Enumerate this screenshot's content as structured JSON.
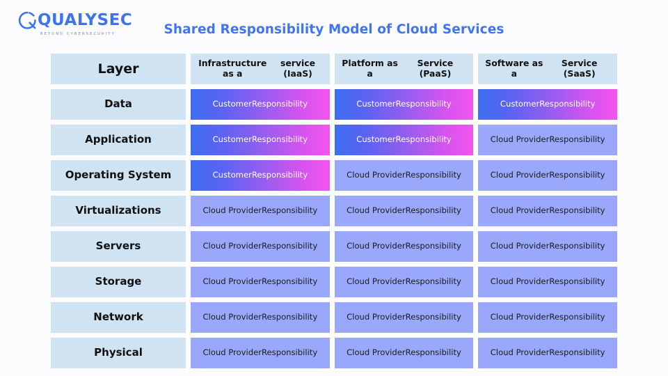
{
  "brand": {
    "name": "QUALYSEC",
    "tagline": "BEYOND CYBERSECURITY",
    "logo_icon": "q-circle-logo-icon",
    "color": "#3c74ef"
  },
  "title": "Shared Responsibility Model of Cloud Services",
  "colors": {
    "title": "#3f75ef",
    "layer_cell": "#cfe3f3",
    "provider_cell": "#99a8fb",
    "customer_gradient_start": "#3f6ff1",
    "customer_gradient_end": "#f355ee",
    "background": "#fcfcfe"
  },
  "labels": {
    "customer": "Customer\nResponsibility",
    "customer_line1": "Customer",
    "customer_line2": "Responsibility",
    "provider_line1": "Cloud Provider",
    "provider_line2": "Responsibility"
  },
  "table": {
    "headers": [
      {
        "line1": "Layer",
        "line2": ""
      },
      {
        "line1": "Infrastructure as a",
        "line2": "service (IaaS)"
      },
      {
        "line1": "Platform as a",
        "line2": "Service  (PaaS)"
      },
      {
        "line1": "Software as a",
        "line2": "Service  (SaaS)"
      }
    ],
    "rows": [
      {
        "layer": "Data",
        "iaas": "customer",
        "paas": "customer",
        "saas": "customer"
      },
      {
        "layer": "Application",
        "iaas": "customer",
        "paas": "customer",
        "saas": "provider"
      },
      {
        "layer": "Operating System",
        "iaas": "customer",
        "paas": "provider",
        "saas": "provider"
      },
      {
        "layer": "Virtualizations",
        "iaas": "provider",
        "paas": "provider",
        "saas": "provider"
      },
      {
        "layer": "Servers",
        "iaas": "provider",
        "paas": "provider",
        "saas": "provider"
      },
      {
        "layer": "Storage",
        "iaas": "provider",
        "paas": "provider",
        "saas": "provider"
      },
      {
        "layer": "Network",
        "iaas": "provider",
        "paas": "provider",
        "saas": "provider"
      },
      {
        "layer": "Physical",
        "iaas": "provider",
        "paas": "provider",
        "saas": "provider"
      }
    ]
  }
}
